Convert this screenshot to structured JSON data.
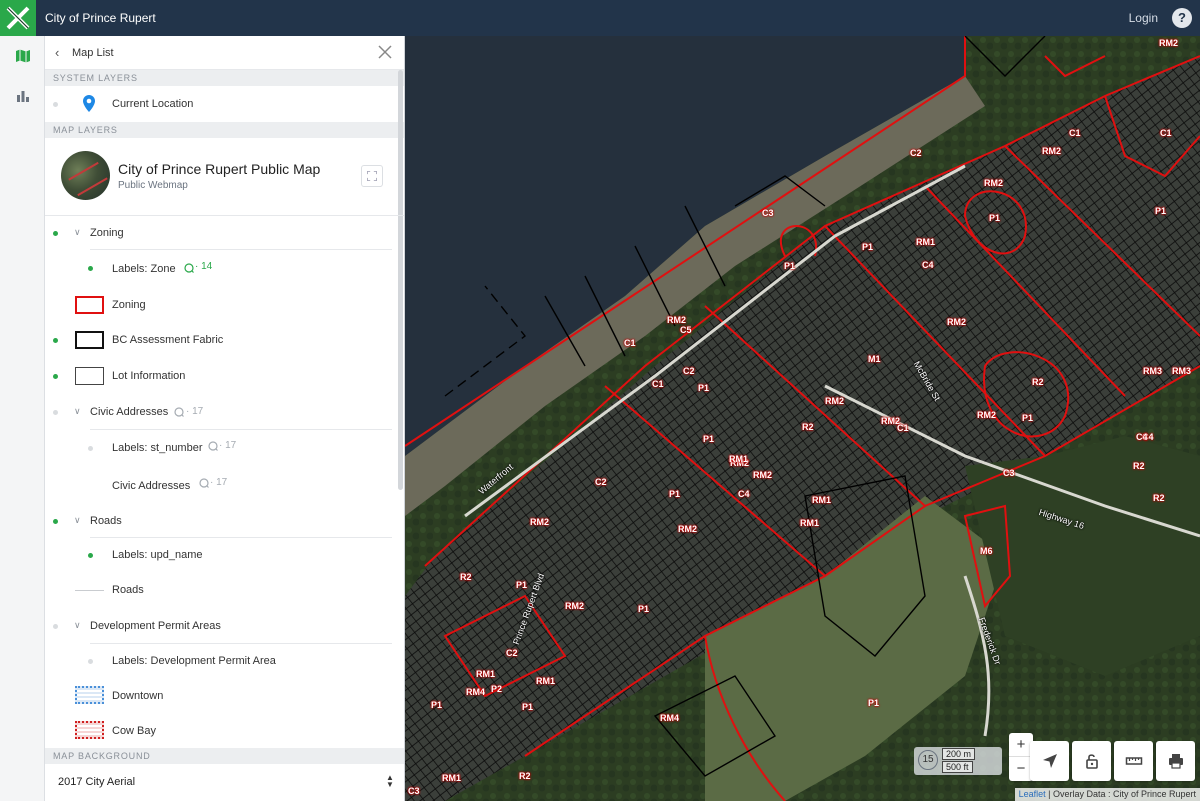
{
  "header": {
    "title": "City of Prince Rupert",
    "login_label": "Login",
    "help_label": "?"
  },
  "panel": {
    "title": "Map List",
    "system_layers_heading": "SYSTEM LAYERS",
    "current_location_label": "Current Location",
    "map_layers_heading": "MAP LAYERS",
    "map_card": {
      "title": "City of Prince Rupert Public Map",
      "subtitle": "Public Webmap"
    },
    "layers": {
      "zoning_group": "Zoning",
      "labels_zone": "Labels: Zone",
      "labels_zone_scale": "· 14",
      "zoning": "Zoning",
      "bc_assessment": "BC Assessment Fabric",
      "lot_information": "Lot Information",
      "civic_group": "Civic Addresses",
      "civic_group_scale": "· 17",
      "labels_st_number": "Labels: st_number",
      "labels_st_number_scale": "· 17",
      "civic_addresses": "Civic Addresses",
      "civic_addresses_scale": "· 17",
      "roads_group": "Roads",
      "labels_upd_name": "Labels: upd_name",
      "roads": "Roads",
      "dpa_group": "Development Permit Areas",
      "labels_dpa": "Labels: Development Permit Area",
      "downtown": "Downtown",
      "cow_bay": "Cow Bay"
    },
    "map_background_heading": "MAP BACKGROUND",
    "background_selected": "2017 City Aerial"
  },
  "map": {
    "zone_labels": [
      "RM2",
      "RM2",
      "C1",
      "C2",
      "RM2",
      "P1",
      "P1",
      "RM1",
      "C4",
      "C3",
      "P1",
      "RM2",
      "C5",
      "C1",
      "RM2",
      "P1",
      "C1",
      "C2",
      "P1",
      "M1",
      "RM2",
      "RM2",
      "R2",
      "RM2",
      "C1",
      "R2",
      "P1",
      "C4",
      "C1",
      "RM1",
      "RM2",
      "C4",
      "C3",
      "C2",
      "P1",
      "RM2",
      "RM1",
      "RM1",
      "M6",
      "P1",
      "RM2",
      "R2",
      "P1",
      "RM2",
      "C2",
      "RM1",
      "RM4",
      "P2",
      "RM1",
      "P1",
      "RM4",
      "RM1",
      "R2",
      "P1",
      "C3",
      "R2",
      "P1",
      "P1",
      "RM3",
      "C4",
      "RM2",
      "RM3",
      "R2"
    ],
    "street_labels": [
      "Waterfront",
      "Highway 16",
      "Prince Rupert Blvd",
      "Frederick Dr",
      "McBride St"
    ],
    "zoom_level": "15",
    "scale_metric": "200 m",
    "scale_imperial": "500 ft",
    "zoom_in": "+",
    "zoom_out": "−",
    "attribution_link": "Leaflet",
    "attribution_text": " | Overlay Data : City of Prince Rupert"
  },
  "colors": {
    "header_bg": "#22344a",
    "accent": "#2aa84a",
    "zone_red": "#e01010",
    "downtown_blue": "#4a90d9",
    "cowbay_red": "#d02020"
  }
}
